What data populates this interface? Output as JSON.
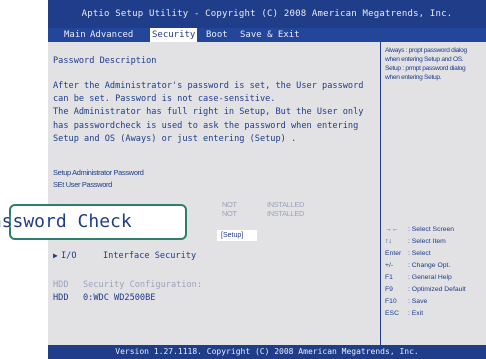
{
  "header": {
    "title": "Aptio Setup Utility - Copyright (C) 2008 American Megatrends, Inc."
  },
  "menu": {
    "tabs": [
      {
        "label": "Main"
      },
      {
        "label": "Advanced"
      },
      {
        "label": "Security",
        "active": true
      },
      {
        "label": "Boot"
      },
      {
        "label": "Save & Exit"
      }
    ]
  },
  "main": {
    "section_title": "Password Description",
    "description_lines": [
      "After the Administrator's password is set, the User password",
      "can be set. Password is not case-sensitive.",
      "The Administrator has full right in Setup, But the User only",
      "has passwordcheck is used to ask the password when entering",
      "Setup and OS (Aways) or just entering (Setup) ."
    ],
    "setup_admin_password": "Setup Administrator Password",
    "set_user_password": "SEt User Password",
    "admin_status_label": "NOT",
    "admin_status_value": "INSTALLED",
    "user_status_label": "NOT",
    "user_status_value": "INSTALLED",
    "password_check_value": "[Setup]",
    "io_arrow": "▶",
    "io_label": "I/O",
    "io_item": "Interface Security",
    "hdd_security_prefix": "HDD",
    "hdd_security_label": "Security Configuration:",
    "hdd_prefix": "HDD",
    "hdd_value": "0:WDC WD2500BE"
  },
  "help": {
    "lines": [
      "Always : propt password dialog",
      "when entering Setup and OS.",
      "Setup : prmpt password dialog",
      "when entering Setup."
    ],
    "keys": [
      {
        "key": "→←",
        "desc": ": Select Screen"
      },
      {
        "key": "↑↓",
        "desc": ": Select Item"
      },
      {
        "key": "Enter",
        "desc": ": Select"
      },
      {
        "key": "+/-",
        "desc": ": Change Opt."
      },
      {
        "key": "F1",
        "desc": ": General Help"
      },
      {
        "key": "F9",
        "desc": ": Optimized Default"
      },
      {
        "key": "F10",
        "desc": ": Save"
      },
      {
        "key": "ESC",
        "desc": ": Exit"
      }
    ]
  },
  "footer": {
    "text": "Version 1.27.1118. Copyright (C) 2008 American Megatrends, Inc."
  },
  "callout": {
    "label": "Password Check"
  },
  "colors": {
    "bios_blue": "#1f3d88",
    "panel_grey": "#e2e2e5",
    "callout_border": "#2f7d6d"
  }
}
